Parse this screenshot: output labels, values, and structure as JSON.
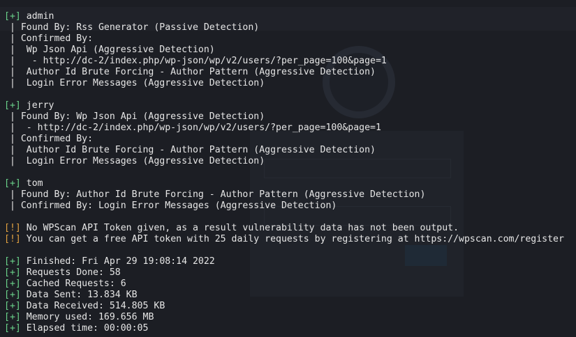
{
  "colors": {
    "background": "#1c1e24",
    "text": "#e6e6e6",
    "plus_tag": "#6ad18a",
    "bang_tag": "#e0a040"
  },
  "lines": [
    {
      "tag": "[+]",
      "tag_type": "plus",
      "text": " admin"
    },
    {
      "tag": "",
      "tag_type": "none",
      "text": " | Found By: Rss Generator (Passive Detection)"
    },
    {
      "tag": "",
      "tag_type": "none",
      "text": " | Confirmed By:"
    },
    {
      "tag": "",
      "tag_type": "none",
      "text": " |  Wp Json Api (Aggressive Detection)"
    },
    {
      "tag": "",
      "tag_type": "none",
      "text": " |   - http://dc-2/index.php/wp-json/wp/v2/users/?per_page=100&page=1"
    },
    {
      "tag": "",
      "tag_type": "none",
      "text": " |  Author Id Brute Forcing - Author Pattern (Aggressive Detection)"
    },
    {
      "tag": "",
      "tag_type": "none",
      "text": " |  Login Error Messages (Aggressive Detection)"
    },
    {
      "tag": "",
      "tag_type": "none",
      "text": ""
    },
    {
      "tag": "[+]",
      "tag_type": "plus",
      "text": " jerry"
    },
    {
      "tag": "",
      "tag_type": "none",
      "text": " | Found By: Wp Json Api (Aggressive Detection)"
    },
    {
      "tag": "",
      "tag_type": "none",
      "text": " |  - http://dc-2/index.php/wp-json/wp/v2/users/?per_page=100&page=1"
    },
    {
      "tag": "",
      "tag_type": "none",
      "text": " | Confirmed By:"
    },
    {
      "tag": "",
      "tag_type": "none",
      "text": " |  Author Id Brute Forcing - Author Pattern (Aggressive Detection)"
    },
    {
      "tag": "",
      "tag_type": "none",
      "text": " |  Login Error Messages (Aggressive Detection)"
    },
    {
      "tag": "",
      "tag_type": "none",
      "text": ""
    },
    {
      "tag": "[+]",
      "tag_type": "plus",
      "text": " tom"
    },
    {
      "tag": "",
      "tag_type": "none",
      "text": " | Found By: Author Id Brute Forcing - Author Pattern (Aggressive Detection)"
    },
    {
      "tag": "",
      "tag_type": "none",
      "text": " | Confirmed By: Login Error Messages (Aggressive Detection)"
    },
    {
      "tag": "",
      "tag_type": "none",
      "text": ""
    },
    {
      "tag": "[!]",
      "tag_type": "bang",
      "text": " No WPScan API Token given, as a result vulnerability data has not been output."
    },
    {
      "tag": "[!]",
      "tag_type": "bang",
      "text": " You can get a free API token with 25 daily requests by registering at https://wpscan.com/register"
    },
    {
      "tag": "",
      "tag_type": "none",
      "text": ""
    },
    {
      "tag": "[+]",
      "tag_type": "plus",
      "text": " Finished: Fri Apr 29 19:08:14 2022"
    },
    {
      "tag": "[+]",
      "tag_type": "plus",
      "text": " Requests Done: 58"
    },
    {
      "tag": "[+]",
      "tag_type": "plus",
      "text": " Cached Requests: 6"
    },
    {
      "tag": "[+]",
      "tag_type": "plus",
      "text": " Data Sent: 13.834 KB"
    },
    {
      "tag": "[+]",
      "tag_type": "plus",
      "text": " Data Received: 514.805 KB"
    },
    {
      "tag": "[+]",
      "tag_type": "plus",
      "text": " Memory used: 169.656 MB"
    },
    {
      "tag": "[+]",
      "tag_type": "plus",
      "text": " Elapsed time: 00:00:05"
    }
  ]
}
